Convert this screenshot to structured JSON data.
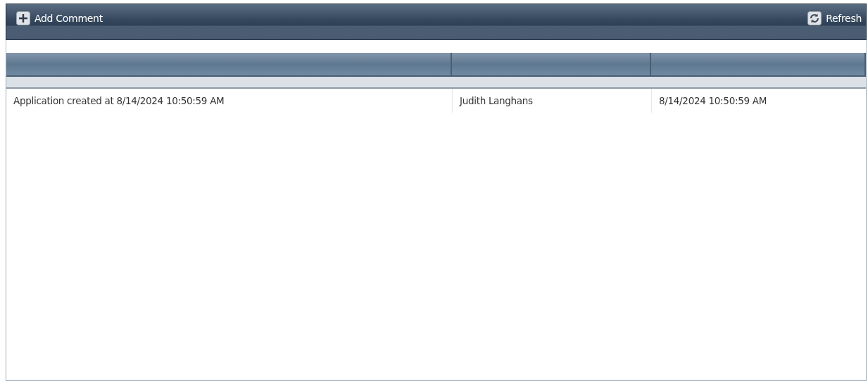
{
  "toolbar": {
    "add_button": "Add Comment",
    "refresh_button": "Refresh"
  },
  "table": {
    "rows": [
      {
        "cells": [
          "Application created at 8/14/2024 10:50:59 AM",
          "Judith Langhans",
          "8/14/2024 10:50:59 AM"
        ]
      }
    ]
  }
}
